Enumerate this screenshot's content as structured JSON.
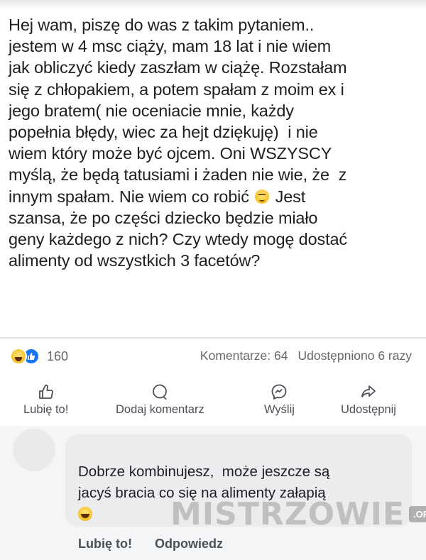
{
  "post": {
    "text_lines": [
      "Hej wam, piszę do was z takim pytaniem..",
      "jestem w 4 msc ciąży, mam 18 lat i nie wiem",
      "jak obliczyć kiedy zaszłam w ciążę. Rozstałam",
      "się z chłopakiem, a potem spałam z moim ex i",
      "jego bratem( nie oceniacie mnie, każdy",
      "popełnia błędy, wiec za hejt dziękuję)  i nie",
      "wiem który może być ojcem. Oni WSZYSCY",
      "myślą, że będą tatusiami i żaden nie wie, że  z",
      "innym spałam. Nie wiem co robić",
      "Jest",
      "szansa, że po części dziecko będzie miało",
      "geny każdego z nich? Czy wtedy mogę dostać",
      "alimenty od wszystkich 3 facetów?"
    ]
  },
  "reactions": {
    "icons": [
      "haha-reaction-icon",
      "like-reaction-icon"
    ],
    "count": "160"
  },
  "stats": {
    "comments": "Komentarze: 64",
    "shares": "Udostępniono 6 razy"
  },
  "actions": {
    "like": "Lubię to!",
    "comment": "Dodaj komentarz",
    "send": "Wyślij",
    "share": "Udostępnij"
  },
  "comment": {
    "line1": "Dobrze kombinujesz,  może jeszcze są",
    "line2": "jacyś bracia co się na alimenty załapią",
    "like": "Lubię to!",
    "reply": "Odpowiedz"
  },
  "watermark": {
    "text": "MISTRZOWIE",
    "badge": ".ORG"
  },
  "colors": {
    "like_blue": "#1877f2",
    "text_grey": "#65676b",
    "bubble": "#ebeced"
  }
}
